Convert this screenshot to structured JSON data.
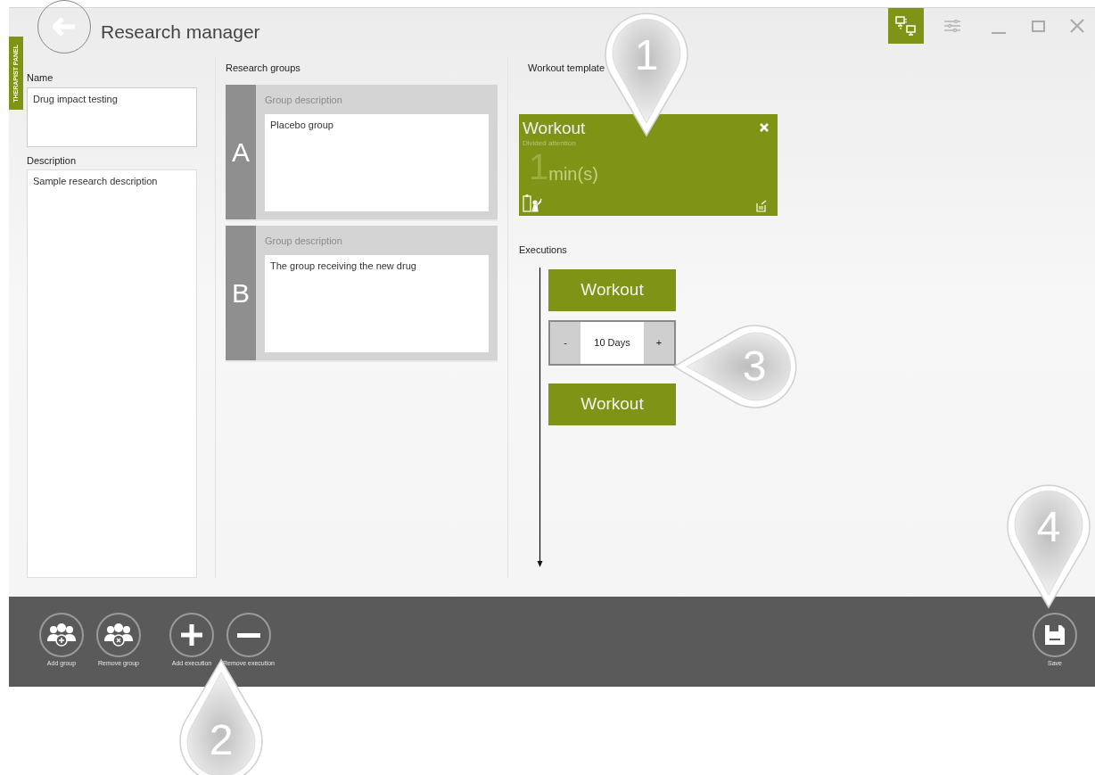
{
  "window": {
    "title": "Research manager"
  },
  "side_tab": {
    "label": "THERAPIST PANEL"
  },
  "view_toggles": [
    {
      "kind": "network",
      "selected": true
    },
    {
      "kind": "settings",
      "selected": false
    }
  ],
  "research": {
    "name_label": "Name",
    "name_value": "Drug impact testing",
    "description_label": "Description",
    "description_value": "Sample research description"
  },
  "groups": {
    "label": "Research groups",
    "items": [
      {
        "letter": "A",
        "caption": "Group description",
        "value": "Placebo group"
      },
      {
        "letter": "B",
        "caption": "Group description",
        "value": "The group receiving the new drug"
      }
    ]
  },
  "template": {
    "label": "Workout template",
    "card": {
      "title": "Workout",
      "subtitle": "Divided attention",
      "amount": "1",
      "unit": "min(s)"
    }
  },
  "executions": {
    "label": "Executions",
    "items": [
      {
        "kind": "workout",
        "label": "Workout"
      },
      {
        "kind": "interval",
        "decrement": "-",
        "value": "10 Days",
        "increment": "+"
      },
      {
        "kind": "workout",
        "label": "Workout"
      }
    ]
  },
  "actions": [
    {
      "kind": "add-group",
      "label": "Add group"
    },
    {
      "kind": "remove-group",
      "label": "Remove group"
    },
    {
      "kind": "add-execution",
      "label": "Add execution"
    },
    {
      "kind": "remove-execution",
      "label": "Remove execution"
    }
  ],
  "save": {
    "label": "Save"
  },
  "callouts": [
    {
      "number": "1"
    },
    {
      "number": "2"
    },
    {
      "number": "3"
    },
    {
      "number": "4"
    }
  ]
}
